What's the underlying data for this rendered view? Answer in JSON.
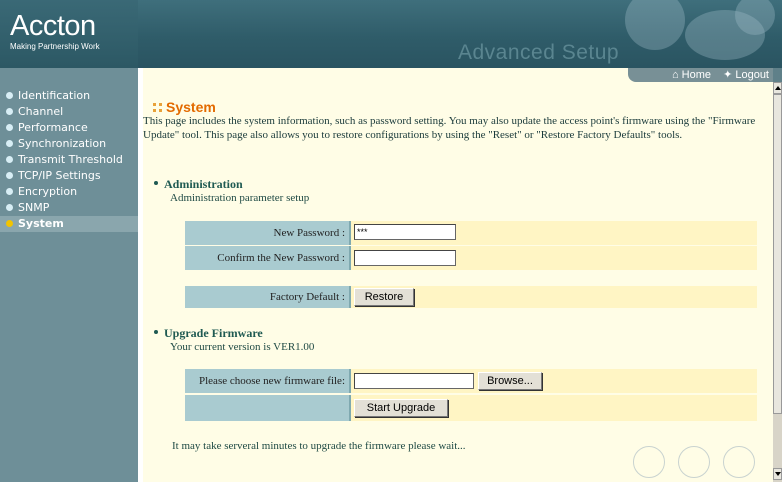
{
  "header": {
    "brand": "Accton",
    "tagline": "Making Partnership Work",
    "title": "Advanced Setup"
  },
  "topnav": {
    "home_label": "Home",
    "logout_label": "Logout"
  },
  "sidebar": {
    "items": [
      {
        "label": "Identification",
        "active": false
      },
      {
        "label": "Channel",
        "active": false
      },
      {
        "label": "Performance",
        "active": false
      },
      {
        "label": "Synchronization",
        "active": false
      },
      {
        "label": "Transmit Threshold",
        "active": false
      },
      {
        "label": "TCP/IP Settings",
        "active": false
      },
      {
        "label": "Encryption",
        "active": false
      },
      {
        "label": "SNMP",
        "active": false
      },
      {
        "label": "System",
        "active": true
      }
    ]
  },
  "main": {
    "title": "System",
    "description": "This page includes the system information, such as password setting. You may also update the access point's firmware using the \"Firmware Update\" tool. This page also allows you to restore configurations by using the \"Reset\" or \"Restore Factory Defaults\" tools.",
    "administration": {
      "heading": "Administration",
      "subtext": "Administration parameter setup",
      "new_password_label": "New Password :",
      "new_password_value": "***",
      "confirm_password_label": "Confirm the New Password :",
      "confirm_password_value": "",
      "factory_default_label": "Factory Default :",
      "restore_button": "Restore"
    },
    "upgrade": {
      "heading": "Upgrade Firmware",
      "version_text": "Your current version is VER1.00",
      "choose_file_label": "Please choose new firmware file:",
      "file_value": "",
      "browse_button": "Browse...",
      "start_button": "Start Upgrade"
    },
    "wait_note": "It may take serveral minutes to upgrade the firmware please wait..."
  },
  "colors": {
    "accent_orange": "#e36a00",
    "sidebar_bg": "#6e8f98",
    "header_bg": "#2f5c69",
    "content_bg": "#fffde6",
    "label_cell": "#a9cbd0",
    "value_cell": "#fff5c4"
  }
}
